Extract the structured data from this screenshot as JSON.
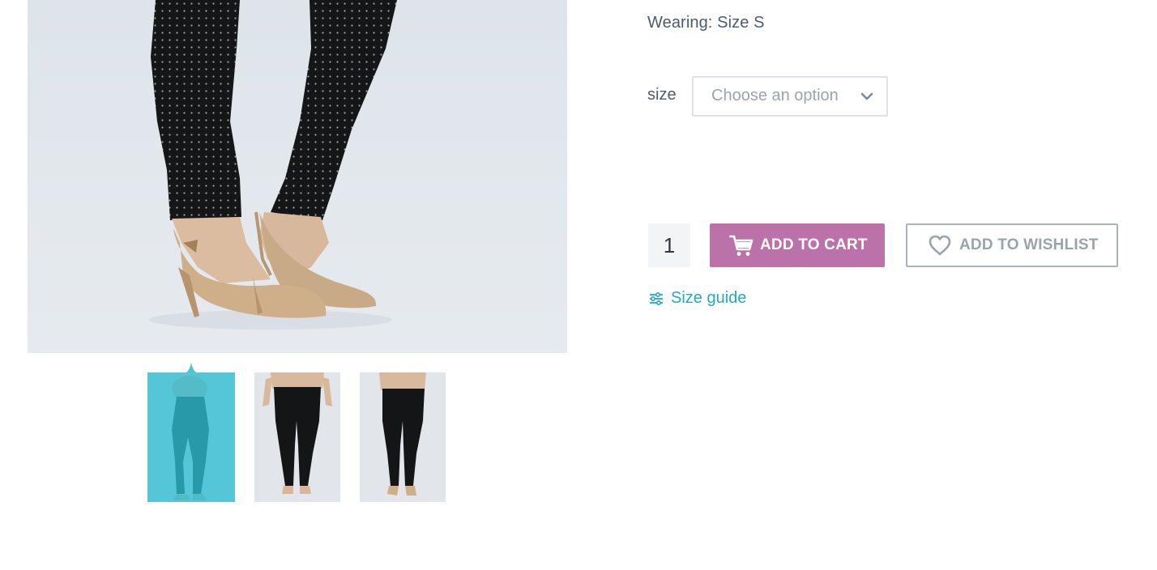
{
  "product": {
    "wearing_text": "Wearing: Size S",
    "size_label": "size",
    "size_placeholder": "Choose an option",
    "quantity": "1",
    "add_to_cart_label": "ADD TO CART",
    "add_to_wishlist_label": "ADD TO WISHLIST",
    "size_guide_label": "Size guide"
  },
  "gallery": {
    "main_image": "maternity-pants-heels-closeup",
    "thumbnails": [
      {
        "image": "maternity-pants-side-view",
        "active": true
      },
      {
        "image": "maternity-pants-front-view",
        "active": false
      },
      {
        "image": "maternity-pants-back-view",
        "active": false
      }
    ]
  },
  "colors": {
    "cart_button": "#bb72a8",
    "accent_teal": "#22a9c4",
    "thumbnail_overlay": "#2dbed2",
    "text_muted": "#4d5b6b"
  },
  "icons": [
    "cart-icon",
    "heart-icon",
    "sliders-icon",
    "chevron-down-icon"
  ]
}
